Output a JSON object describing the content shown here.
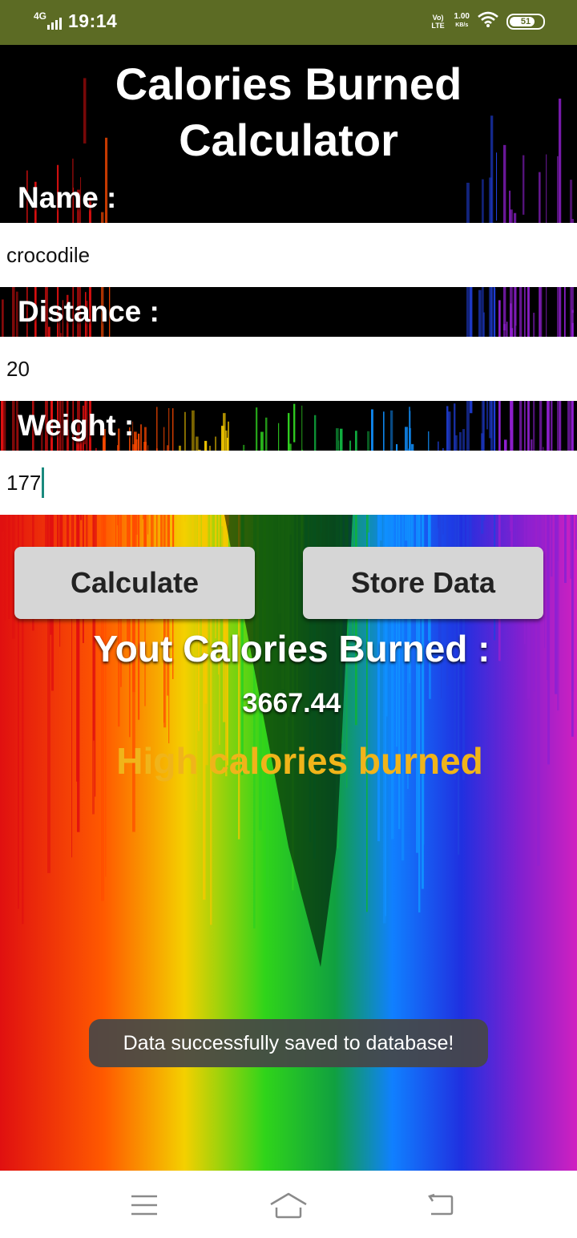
{
  "status_bar": {
    "network": "4G",
    "time": "19:14",
    "volte": "Vo) LTE",
    "speed_value": "1.00",
    "speed_unit": "KB/s",
    "battery": "51",
    "battery_level": 0.51,
    "color": "#5c6b24"
  },
  "app": {
    "title_line1": "Calories Burned",
    "title_line2": "Calculator"
  },
  "form": {
    "name_label": "Name :",
    "name_value": "crocodile",
    "distance_label": "Distance :",
    "distance_value": "20",
    "weight_label": "Weight :",
    "weight_value": "177"
  },
  "buttons": {
    "calculate": "Calculate",
    "store": "Store Data"
  },
  "result": {
    "label": "Yout Calories Burned :",
    "value": "3667.44",
    "status": "High calories burned",
    "status_color": "#f0b41a"
  },
  "toast": {
    "message": "Data successfully saved to database!"
  },
  "nav": {
    "icons": [
      "menu-icon",
      "home-icon",
      "back-icon"
    ]
  }
}
